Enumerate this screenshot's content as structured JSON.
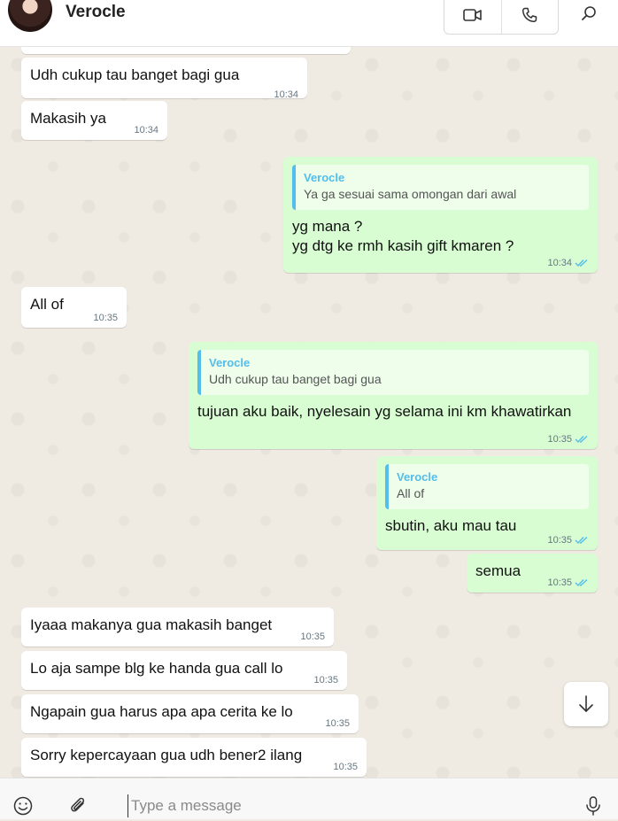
{
  "header": {
    "contact_name": "Verocle",
    "icons": [
      "video-call-icon",
      "voice-call-icon",
      "search-icon"
    ]
  },
  "messages": [
    {
      "dir": "in",
      "text": "Udh cukup tau banget bagi gua",
      "time": "10:34"
    },
    {
      "dir": "in",
      "text": "Makasih ya",
      "time": "10:34"
    },
    {
      "dir": "out",
      "quote_author": "Verocle",
      "quote_text": "Ya ga sesuai sama omongan dari awal",
      "line1": "yg mana ?",
      "line2": "yg dtg ke rmh kasih gift kmaren ?",
      "time": "10:34"
    },
    {
      "dir": "in",
      "text": "All of",
      "time": "10:35"
    },
    {
      "dir": "out",
      "quote_author": "Verocle",
      "quote_text": "Udh cukup tau banget bagi gua",
      "text": "tujuan aku baik, nyelesain yg selama ini km khawatirkan",
      "time": "10:35"
    },
    {
      "dir": "out",
      "quote_author": "Verocle",
      "quote_text": "All of",
      "text": "sbutin, aku mau tau",
      "time": "10:35"
    },
    {
      "dir": "out",
      "text": "semua",
      "time": "10:35"
    },
    {
      "dir": "in",
      "text": "Iyaaa makanya gua makasih banget",
      "time": "10:35"
    },
    {
      "dir": "in",
      "text": "Lo aja sampe blg ke handa gua call lo",
      "time": "10:35"
    },
    {
      "dir": "in",
      "text": "Ngapain gua harus apa apa cerita ke lo",
      "time": "10:35"
    },
    {
      "dir": "in",
      "text": "Sorry kepercayaan gua udh bener2 ilang",
      "time": "10:35"
    }
  ],
  "composer": {
    "placeholder": "Type a message"
  },
  "colors": {
    "incoming_bubble": "#ffffff",
    "outgoing_bubble": "#d9fdd3",
    "quote_accent": "#53bdeb",
    "read_tick": "#53bdeb",
    "chat_background": "#efeae2"
  }
}
